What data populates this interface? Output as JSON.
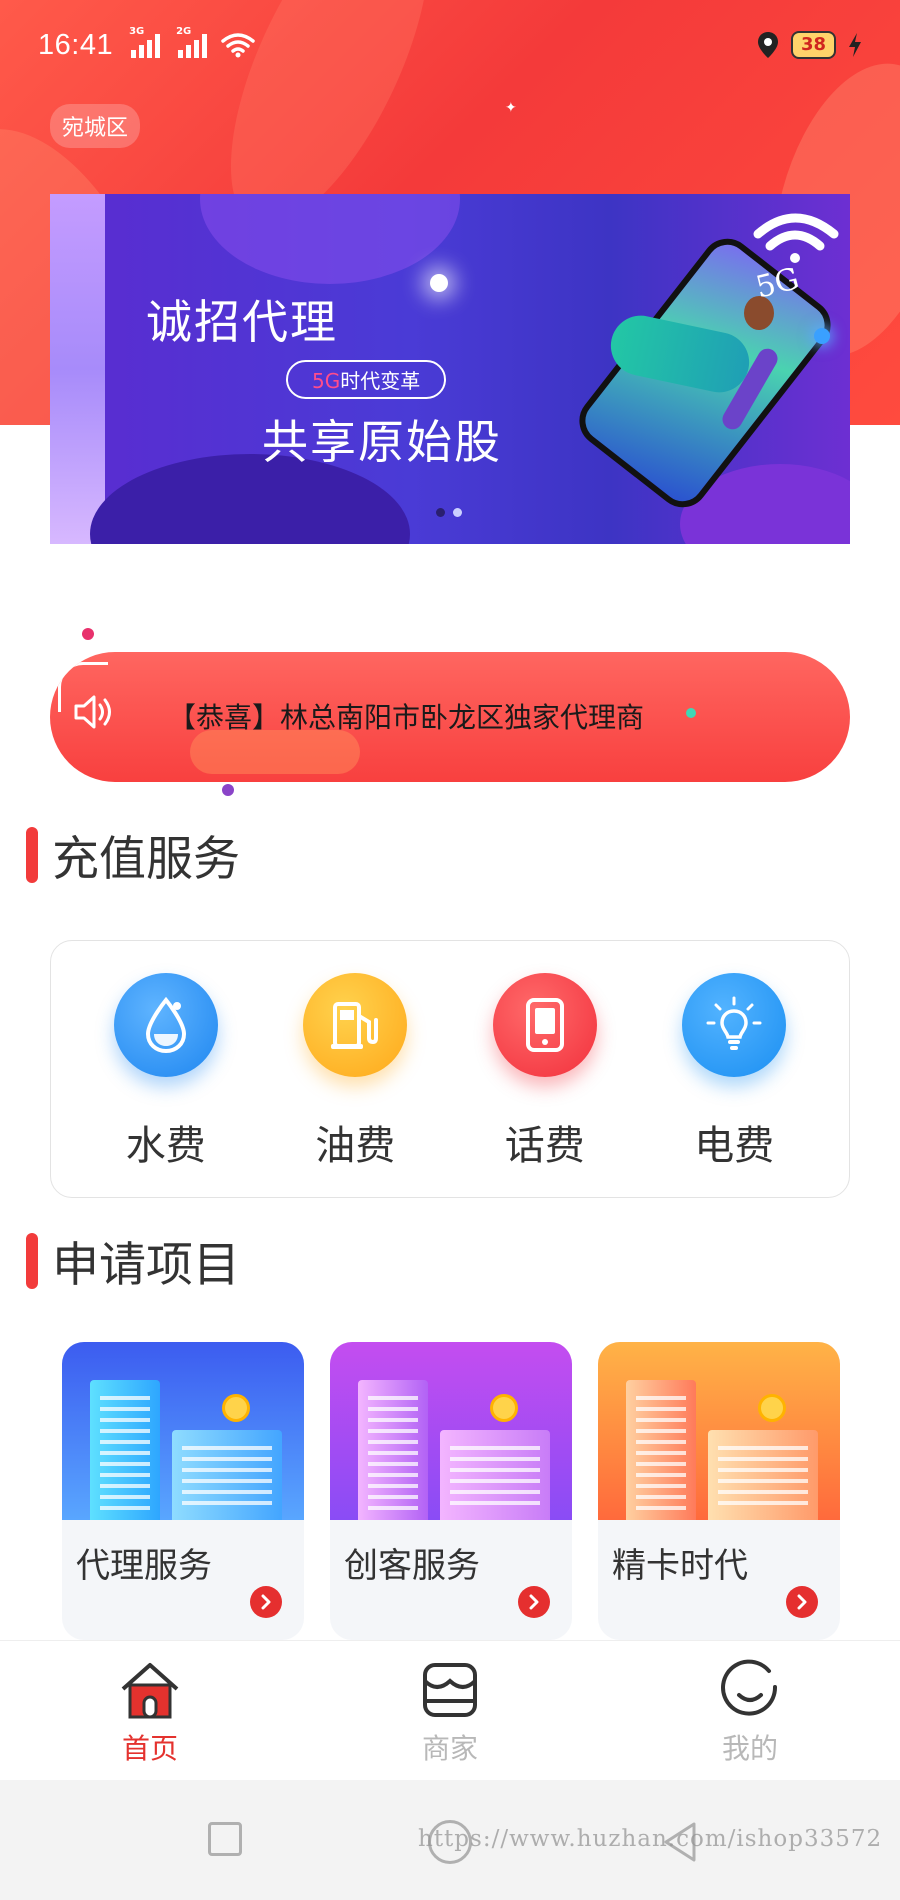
{
  "status_bar": {
    "time": "16:41",
    "signal1_tag": "3G",
    "signal2_tag": "2G",
    "battery": "38"
  },
  "header": {
    "region": "宛城区"
  },
  "banner": {
    "title": "诚招代理",
    "pill_highlight": "5G",
    "pill_rest": "时代变革",
    "subtitle": "共享原始股",
    "phone_label": "5G",
    "slide_count": 2,
    "active_slide": 0
  },
  "notice": {
    "text": "【恭喜】林总南阳市卧龙区独家代理商"
  },
  "recharge": {
    "title": "充值服务",
    "items": [
      {
        "label": "水费",
        "icon": "water-drop-icon",
        "color": "#1e86f0"
      },
      {
        "label": "油费",
        "icon": "fuel-pump-icon",
        "color": "#ffa81a"
      },
      {
        "label": "话费",
        "icon": "phone-icon",
        "color": "#f2303c"
      },
      {
        "label": "电费",
        "icon": "light-bulb-icon",
        "color": "#1b8ff2"
      }
    ]
  },
  "projects": {
    "title": "申请项目",
    "items": [
      {
        "label": "代理服务"
      },
      {
        "label": "创客服务"
      },
      {
        "label": "精卡时代"
      }
    ]
  },
  "tabbar": {
    "items": [
      {
        "label": "首页",
        "icon": "home-icon",
        "active": true
      },
      {
        "label": "商家",
        "icon": "store-icon",
        "active": false
      },
      {
        "label": "我的",
        "icon": "profile-icon",
        "active": false
      }
    ]
  },
  "watermark": "https://www.huzhan.com/ishop33572",
  "colors": {
    "accent": "#e4322e",
    "inactive": "#b8b8b8"
  }
}
